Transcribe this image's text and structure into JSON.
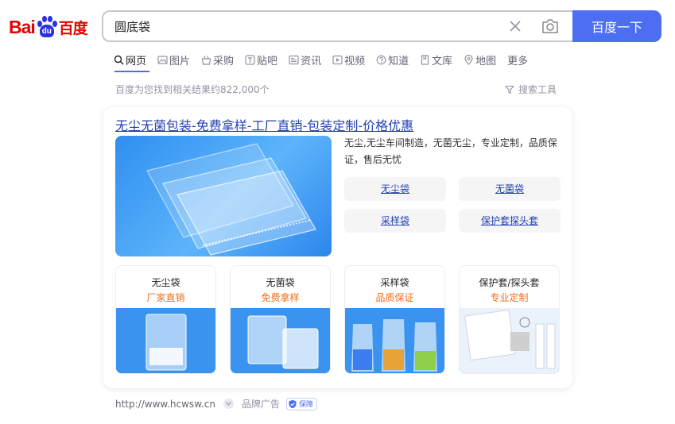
{
  "logo": {
    "bai": "Bai",
    "du": "du",
    "cn": "百度"
  },
  "search": {
    "query": "圆底袋",
    "button_label": "百度一下"
  },
  "tabs": [
    {
      "label": "网页",
      "icon": "search-icon",
      "active": true
    },
    {
      "label": "图片",
      "icon": "image-icon"
    },
    {
      "label": "采购",
      "icon": "basket-icon"
    },
    {
      "label": "贴吧",
      "icon": "tieba-icon"
    },
    {
      "label": "资讯",
      "icon": "news-icon"
    },
    {
      "label": "视频",
      "icon": "video-icon"
    },
    {
      "label": "知道",
      "icon": "question-icon"
    },
    {
      "label": "文库",
      "icon": "document-icon"
    },
    {
      "label": "地图",
      "icon": "map-pin-icon"
    },
    {
      "label": "更多",
      "icon": ""
    }
  ],
  "results_info": {
    "count_text": "百度为您找到相关结果约822,000个",
    "tools_label": "搜索工具"
  },
  "ad_card": {
    "title": "无尘无菌包装-免费拿样-工厂直销-包装定制-价格优惠",
    "description": "无尘,无尘车间制造，无菌无尘，专业定制，品质保证，售后无忧",
    "sub_links": [
      "无尘袋",
      "无菌袋",
      "采样袋",
      "保护套探头套"
    ],
    "products": [
      {
        "name": "无尘袋",
        "tag": "厂家直销"
      },
      {
        "name": "无菌袋",
        "tag": "免费拿样"
      },
      {
        "name": "采样袋",
        "tag": "品质保证"
      },
      {
        "name": "保护套/探头套",
        "tag": "专业定制"
      }
    ]
  },
  "footer": {
    "url": "http://www.hcwsw.cn",
    "ad_label": "品牌广告",
    "badge": "保障"
  },
  "colors": {
    "brand_blue": "#4e6ef2",
    "logo_red": "#e10601",
    "link_blue": "#2440b3",
    "tag_orange": "#f26e1b"
  }
}
